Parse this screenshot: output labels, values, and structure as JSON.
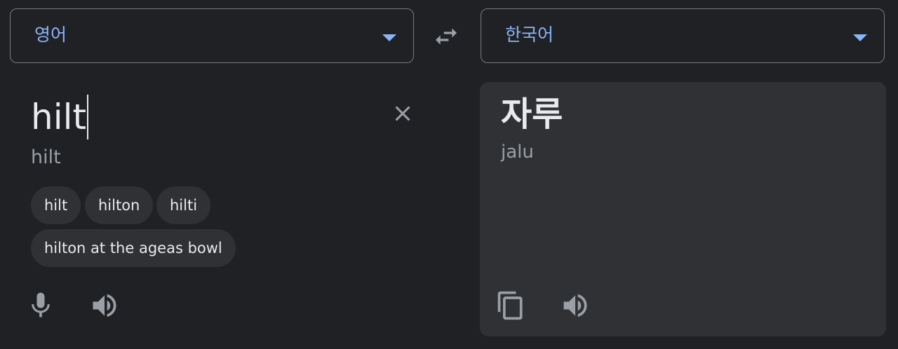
{
  "languages": {
    "source": "영어",
    "target": "한국어"
  },
  "source": {
    "text": "hilt",
    "romanization": "hilt",
    "suggestions": [
      "hilt",
      "hilton",
      "hilti",
      "hilton at the ageas bowl"
    ]
  },
  "target": {
    "text": "자루",
    "romanization": "jalu"
  },
  "icons": {
    "swap": "swap-arrows-icon",
    "clear": "close-icon",
    "mic": "microphone-icon",
    "speaker": "speaker-icon",
    "copy": "copy-icon"
  },
  "colors": {
    "background": "#202124",
    "panel": "#303134",
    "accent": "#8ab4f8",
    "text": "#e8eaed",
    "muted": "#9aa0a6"
  }
}
